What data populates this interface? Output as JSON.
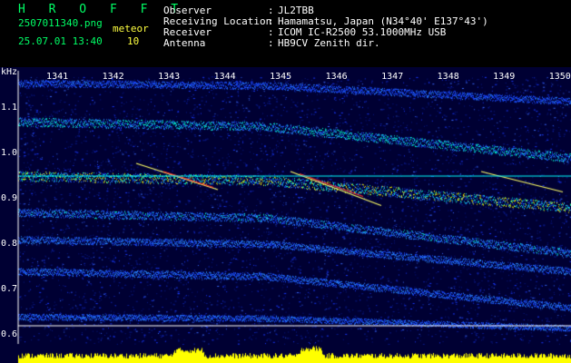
{
  "header": {
    "logo": "H R O F F T",
    "filename": "2507011340.png",
    "datetime": "25.07.01 13:40",
    "meteor_label": "meteor",
    "meteor_count": "10",
    "info_labels": [
      "Observer",
      "Receiving Location",
      "Receiver",
      "Antenna"
    ],
    "info_colons": [
      ":",
      ":",
      ":",
      ":"
    ],
    "info_values": [
      "JL2TBB",
      "Hamamatsu, Japan (N34°40' E137°43')",
      "ICOM IC-R2500 53.1000MHz USB",
      "HB9CV Zenith dir."
    ]
  },
  "chart_data": {
    "type": "heatmap",
    "ylabel": "kHz",
    "y_ticks": [
      "1.1",
      "1.0",
      "0.9",
      "0.8",
      "0.7",
      "0.6"
    ],
    "x_ticks": [
      "1341",
      "1342",
      "1343",
      "1344",
      "1345",
      "1346",
      "1347",
      "1348",
      "1349",
      "1350"
    ],
    "ylim": [
      0.58,
      1.17
    ],
    "xlim": [
      1340.3,
      1350.2
    ],
    "reference_lines_khz": [
      0.95,
      0.62
    ],
    "colors": {
      "background": "#000033",
      "noise": "#1a3aff",
      "signal": "#00ffcc",
      "strong": "#ffff00",
      "peak": "#ff3030",
      "level_bar": "#ffff00"
    }
  }
}
